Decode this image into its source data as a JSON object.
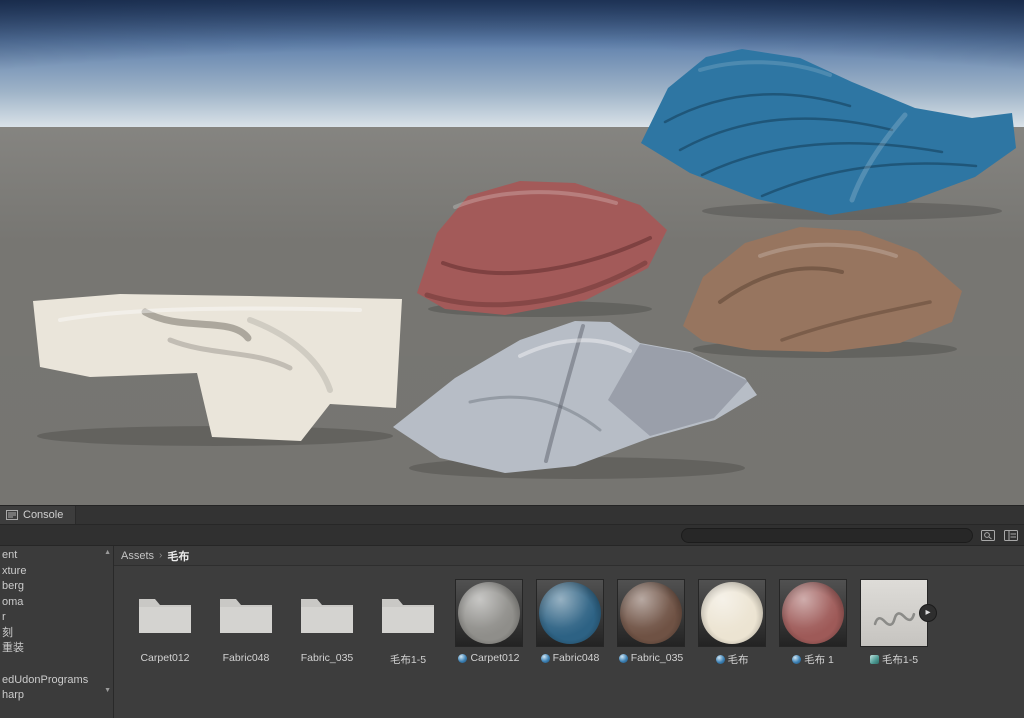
{
  "scene": {
    "ground_color": "#7c7b77",
    "fabrics": [
      {
        "name": "white-fabric",
        "color": "#eae5da"
      },
      {
        "name": "red-fabric",
        "color": "#a35a59"
      },
      {
        "name": "blue-fabric",
        "color": "#2e76a3"
      },
      {
        "name": "brown-fabric",
        "color": "#97755f"
      },
      {
        "name": "gray-fabric",
        "color": "#b7bdc6"
      }
    ]
  },
  "console": {
    "tab_label": "Console"
  },
  "toolbar": {
    "search_value": "",
    "search_placeholder": ""
  },
  "icons": {
    "scroll_up": "▲",
    "scroll_down": "▼",
    "expand_arrow": "▸",
    "breadcrumb_sep": "›"
  },
  "project": {
    "breadcrumb": {
      "root": "Assets",
      "current": "毛布"
    },
    "sidebar": {
      "items_top": [
        "ent",
        "xture",
        "berg",
        "oma",
        "r",
        "刻",
        "重装"
      ],
      "items_bottom": [
        "edUdonPrograms",
        "harp"
      ]
    },
    "folders": [
      {
        "label": "Carpet012"
      },
      {
        "label": "Fabric048"
      },
      {
        "label": "Fabric_035"
      },
      {
        "label": "毛布1-5"
      }
    ],
    "materials": [
      {
        "label": "Carpet012",
        "color": "#8f8e8a"
      },
      {
        "label": "Fabric048",
        "color": "#2d6284"
      },
      {
        "label": "Fabric_035",
        "color": "#6f5244"
      },
      {
        "label": "毛布",
        "color": "#ece4d2"
      },
      {
        "label": "毛布 1",
        "color": "#9e5a58"
      }
    ],
    "model_asset": {
      "label": "毛布1-5"
    }
  }
}
